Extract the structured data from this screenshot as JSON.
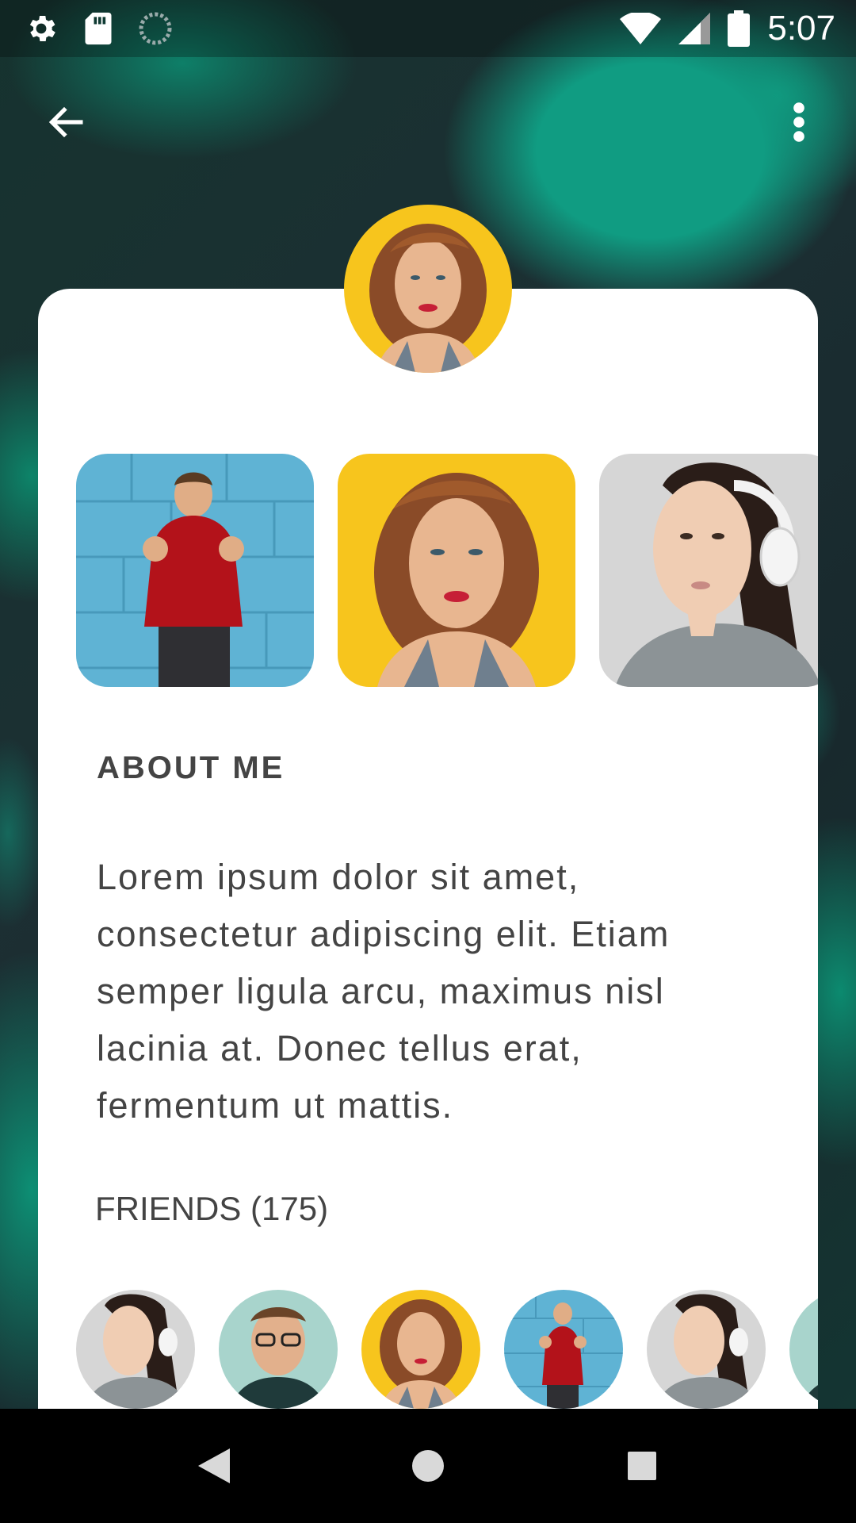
{
  "status_bar": {
    "time": "5:07",
    "icons": [
      "settings-icon",
      "sd-card-icon",
      "sync-icon",
      "wifi-icon",
      "cell-signal-icon",
      "battery-icon"
    ]
  },
  "app_bar": {
    "back_icon": "arrow-back-icon",
    "menu_icon": "more-vert-icon"
  },
  "profile": {
    "avatar": "portrait-woman-yellow"
  },
  "gallery": {
    "photos": [
      "man-red-sweater-blue-wall",
      "woman-yellow-background",
      "woman-white-headphones"
    ]
  },
  "about": {
    "heading": "ABOUT ME",
    "text": "Lorem ipsum dolor sit amet, consectetur adipiscing elit. Etiam semper ligula arcu,  maximus nisl lacinia at. Donec tellus erat, fermentum ut mattis."
  },
  "friends": {
    "heading": "FRIENDS (175)",
    "avatars": [
      "woman-headphones",
      "man-glasses",
      "woman-yellow",
      "man-red-sweater",
      "woman-headphones",
      "man-partial"
    ]
  },
  "nav_bar": {
    "buttons": [
      "back-triangle-icon",
      "home-circle-icon",
      "recents-square-icon"
    ]
  },
  "colors": {
    "accent_teal": "#109c82",
    "card_bg": "#ffffff",
    "text": "#444444",
    "yellow": "#f7c51d",
    "blue_wall": "#5fb3d4",
    "red_sweater": "#b3121a"
  }
}
